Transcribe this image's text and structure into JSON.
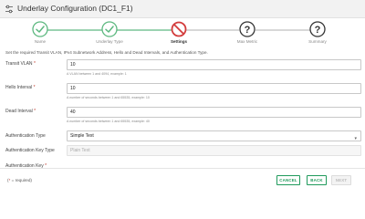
{
  "window": {
    "title": "Underlay Configuration (DC1_F1)",
    "icon": "sliders-icon"
  },
  "stepper": {
    "steps": [
      {
        "label": "Name",
        "state": "complete",
        "icon": "check-icon"
      },
      {
        "label": "Underlay Type",
        "state": "complete",
        "icon": "check-icon"
      },
      {
        "label": "Settings",
        "state": "error",
        "icon": "prohibited-icon"
      },
      {
        "label": "Max Metric",
        "state": "pending",
        "icon": "question-icon"
      },
      {
        "label": "Summary",
        "state": "pending",
        "icon": "question-icon"
      }
    ],
    "colors": {
      "complete": "#5cb87f",
      "error": "#d33c3c",
      "pending": "#333333",
      "track_done": "#9bd3b1",
      "track_todo": "#d8d8d8"
    }
  },
  "form": {
    "description": "Set the required Transit VLAN, IPv4 Subnetwork Address, Hello and Dead Intervals, and Authentication Type.",
    "fields": {
      "transit_vlan": {
        "label": "Transit VLAN",
        "required_mark": "*",
        "value": "10",
        "hint": "A VLAN between 1 and 4094, example: 1"
      },
      "hello_interval": {
        "label": "Hello Interval",
        "required_mark": "*",
        "value": "10",
        "hint": "A number of seconds between 1 and 65535, example: 10"
      },
      "dead_interval": {
        "label": "Dead Interval",
        "required_mark": "*",
        "value": "40",
        "hint": "A number of seconds between 1 and 65535, example: 40"
      },
      "auth_type": {
        "label": "Authentication Type",
        "value": "Simple Text"
      },
      "auth_key_type": {
        "label": "Authentication Key Type",
        "placeholder": "Plain Text"
      },
      "auth_key": {
        "label": "Authentication Key",
        "required_mark": "*"
      }
    }
  },
  "footer": {
    "required_note_prefix": "(",
    "required_note_mark": "*",
    "required_note_suffix": " = required)",
    "buttons": {
      "cancel": "CANCEL",
      "back": "BACK",
      "next": "NEXT"
    },
    "accent": "#1f9a5b"
  }
}
